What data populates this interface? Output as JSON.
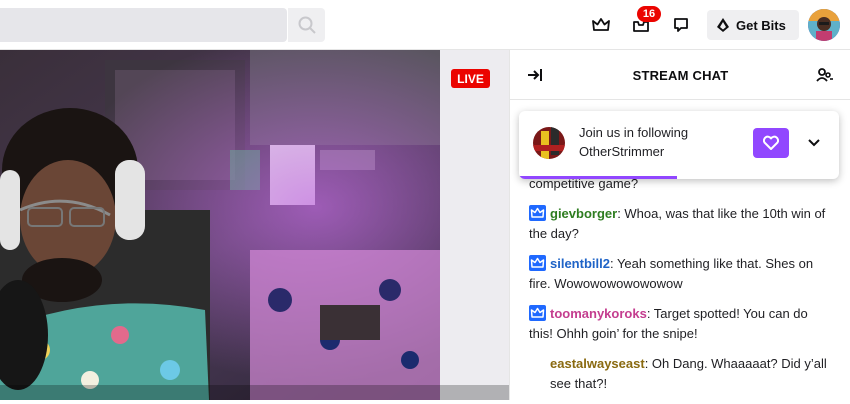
{
  "header": {
    "notification_count": "16",
    "get_bits_label": "Get Bits"
  },
  "player": {
    "live_label": "LIVE"
  },
  "chat": {
    "title": "STREAM CHAT",
    "follow_prompt": {
      "line1": "Join us in following",
      "line2": "OtherStrimmer"
    },
    "messages": [
      {
        "user": "",
        "text": "competitive game?",
        "color": "#1f1f23",
        "badge": false
      },
      {
        "user": "gievborger",
        "text": ": Whoa, was that like the 10th win of the day?",
        "color": "#2e7d20",
        "badge": true
      },
      {
        "user": "silentbill2",
        "text": ": Yeah something like that. Shes on fire. Wowowowowowowow",
        "color": "#1e63c7",
        "badge": true
      },
      {
        "user": "toomanykoroks",
        "text": ": Target spotted! You can do this! Ohhh goin’ for the snipe!",
        "color": "#c43d8f",
        "badge": true
      },
      {
        "user": "eastalwayseast",
        "text": ": Oh Dang. Whaaaaat? Did y’all see that?!",
        "color": "#8a6a10",
        "badge": false
      }
    ]
  },
  "colors": {
    "accent": "#9147ff",
    "live": "#eb0400",
    "sub_badge": "#1f69ff"
  }
}
